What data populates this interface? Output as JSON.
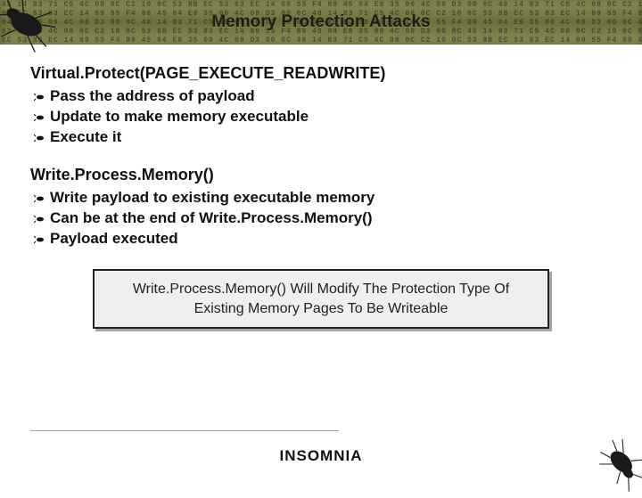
{
  "title": "Memory Protection Attacks",
  "sections": [
    {
      "heading": "Virtual.Protect(PAGE_EXECUTE_READWRITE)",
      "bullets": [
        "Pass the address of payload",
        "Update to make memory executable",
        "Execute it"
      ]
    },
    {
      "heading": "Write.Process.Memory()",
      "bullets": [
        "Write payload to existing executable memory",
        "Can be at the end of Write.Process.Memory()",
        "Payload executed"
      ]
    }
  ],
  "callout": "Write.Process.Memory() Will Modify The Protection Type Of Existing Memory Pages To Be Writeable",
  "brand": "INSOMNIA",
  "hex_filler": "48 14 83 71 C5 4C 08 0C C2 10 0C 53 8B EC 53 83 EC 14 89 55 F4 89 45 04 E8 35 00 4C 08 D3 00 0C 48 14 83 71 C5 4C 08 0C C2 10 0C 53\n8B EC 53 83 EC 14 89 55 F4 89 45 04 E8 35 00 4C 08 D3 00 0C 48 14 83 71 C5 4C 08 0C C2 10 0C 53 8B EC 53 83 EC 14 89 55 F4 89 45\n04 E8 35 00 4C 08 D3 00 0C 48 14 83 71 C5 4C 08 0C C2 10 0C 53 8B EC 53 83 EC 14 89 55 F4 89 45 04 E8 35 00 4C 08 D3 00 0C 48 14\n83 71 C5 4C 08 0C C2 10 0C 53 8B EC 53 83 EC 14 89 55 F4 89 45 04 E8 35 00 4C 08 D3 00 0C 48 14 83 71 C5 4C 08 0C C2 10 0C 53 8B\nEC 53 83 EC 14 89 55 F4 89 45 04 E8 35 00 4C 08 D3 00 0C 48 14 83 71 C5 4C 08 0C C2 10 0C 53 8B EC 53 83 EC 14 89 55 F4 89 45 04"
}
